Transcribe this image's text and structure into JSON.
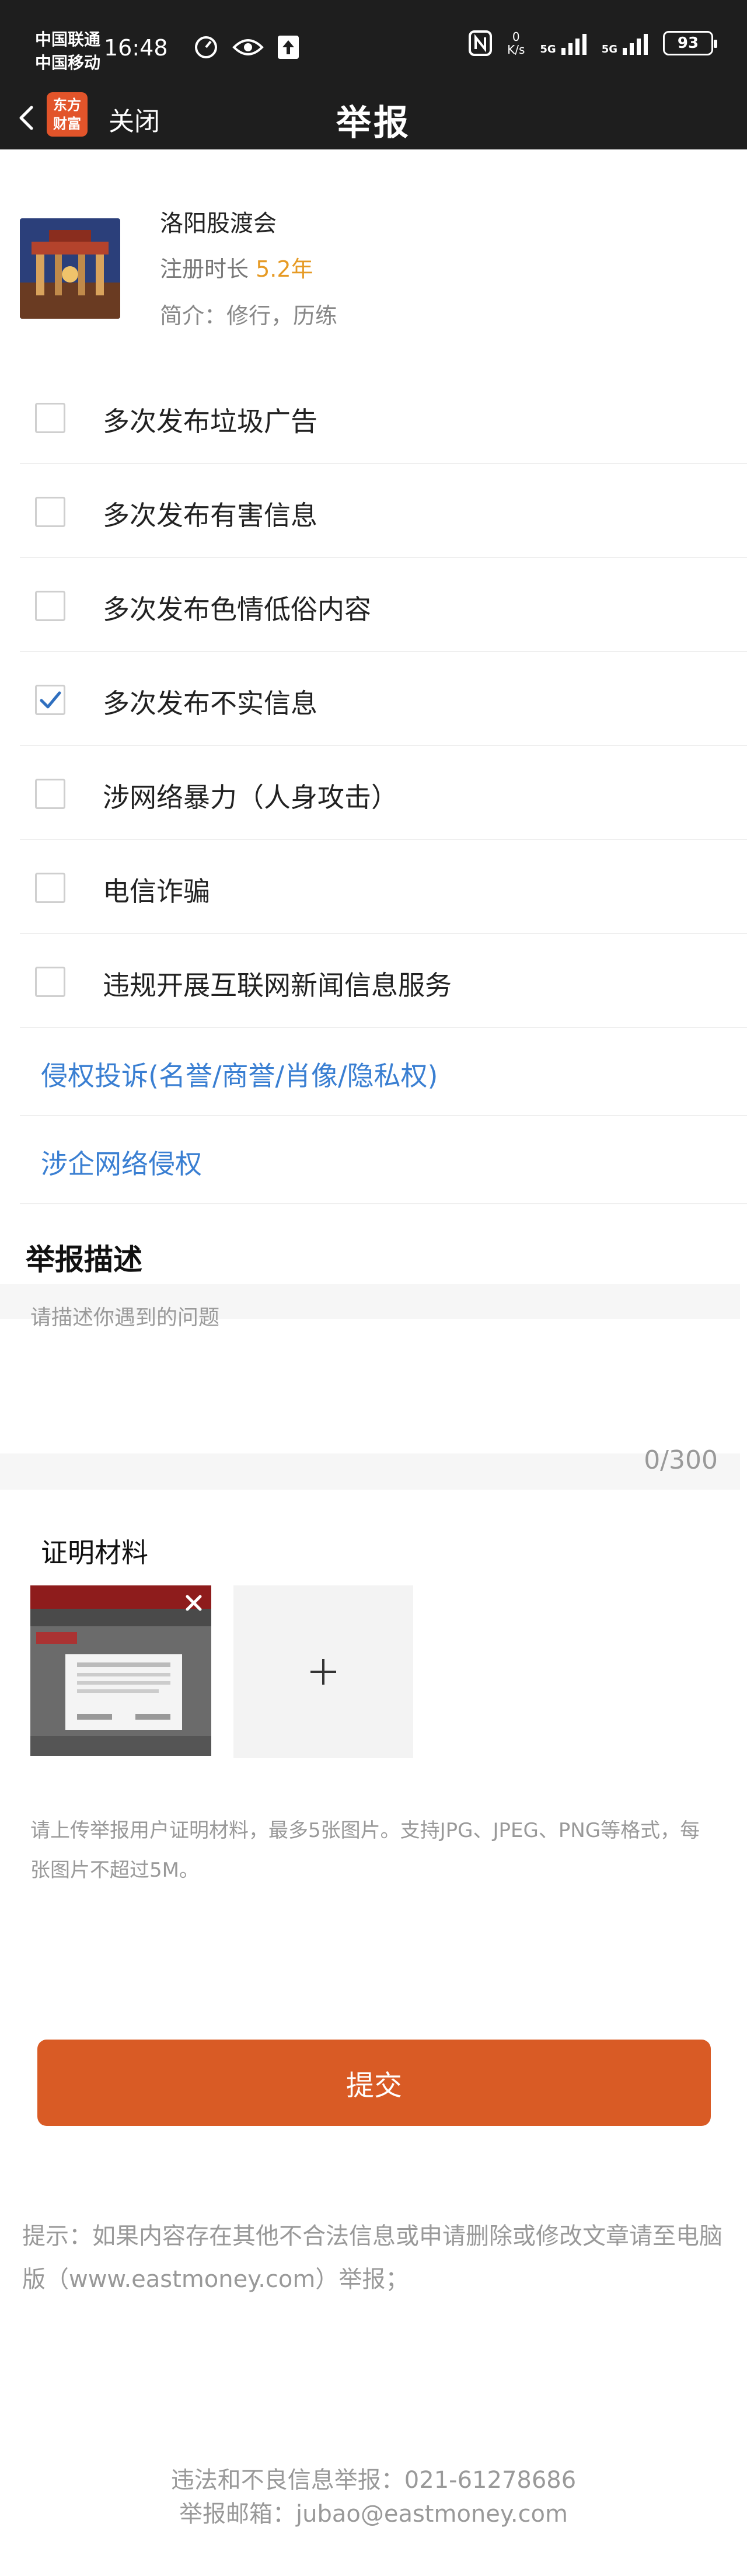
{
  "status_bar": {
    "carrier_1": "中国联通",
    "carrier_2": "中国移动",
    "time": "16:48",
    "net_speed_value": "0",
    "net_speed_unit": "K/s",
    "network_1": "5G",
    "network_2": "5G",
    "battery": "93"
  },
  "header": {
    "logo_text_1": "东方",
    "logo_text_2": "财富",
    "close_label": "关闭",
    "title": "举报"
  },
  "profile": {
    "name": "洛阳股渡会",
    "registered_label": "注册时长 ",
    "registered_value": "5.2年",
    "intro": "简介：修行，历练"
  },
  "report_options": [
    {
      "label": "多次发布垃圾广告",
      "checked": false
    },
    {
      "label": "多次发布有害信息",
      "checked": false
    },
    {
      "label": "多次发布色情低俗内容",
      "checked": false
    },
    {
      "label": "多次发布不实信息",
      "checked": true
    },
    {
      "label": "涉网络暴力（人身攻击）",
      "checked": false
    },
    {
      "label": "电信诈骗",
      "checked": false
    },
    {
      "label": "违规开展互联网新闻信息服务",
      "checked": false
    }
  ],
  "links": [
    {
      "label": "侵权投诉(名誉/商誉/肖像/隐私权)"
    },
    {
      "label": "涉企网络侵权"
    }
  ],
  "description": {
    "title": "举报描述",
    "placeholder": "请描述你遇到的问题",
    "counter": "0/300"
  },
  "evidence": {
    "title": "证明材料",
    "hint": "请上传举报用户证明材料，最多5张图片。支持JPG、JPEG、PNG等格式，每张图片不超过5M。"
  },
  "submit_label": "提交",
  "tip": "提示：如果内容存在其他不合法信息或申请删除或修改文章请至电脑版（www.eastmoney.com）举报；",
  "footer": {
    "phone": "违法和不良信息举报：021-61278686",
    "email": "举报邮箱：jubao@eastmoney.com"
  },
  "colors": {
    "accent": "#d95b25",
    "link": "#3a7fd2",
    "highlight": "#e69a24",
    "checkmark": "#2f6fbf"
  }
}
